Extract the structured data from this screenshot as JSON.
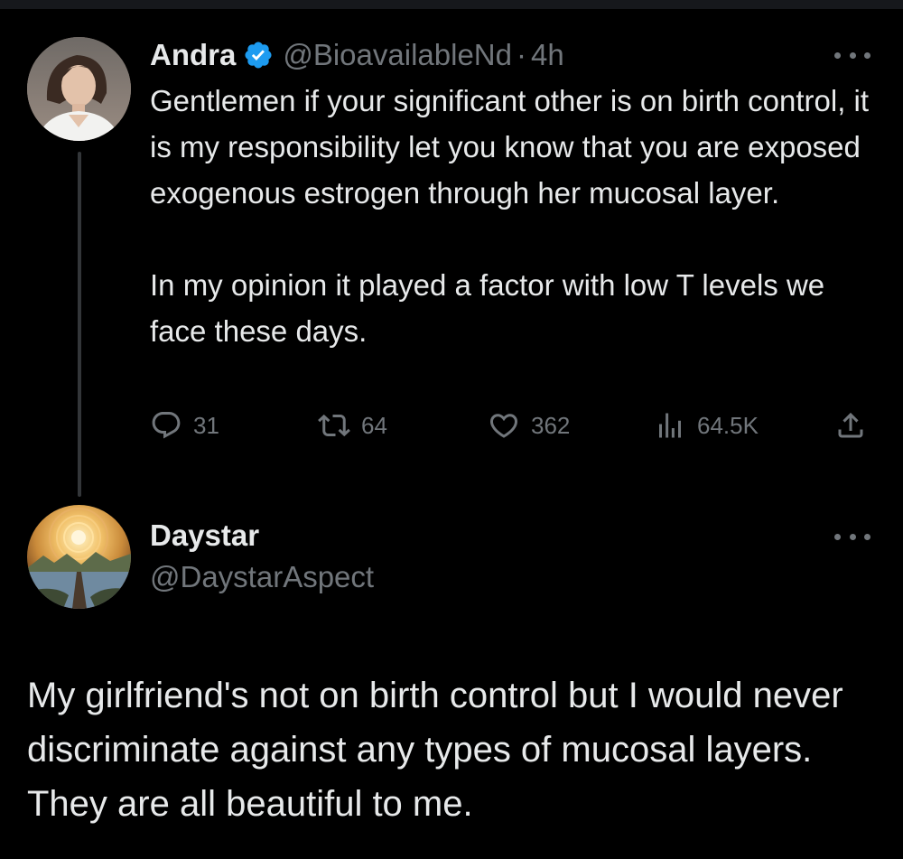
{
  "theme": {
    "background": "#000000",
    "text": "#e7e9ea",
    "muted": "#71767b",
    "verified": "#1d9bf0",
    "thread_line": "#333639"
  },
  "parent_tweet": {
    "display_name": "Andra",
    "verified": true,
    "handle": "@BioavailableNd",
    "separator": "·",
    "time": "4h",
    "more_icon": "more-horizontal-icon",
    "paragraphs": [
      "Gentlemen if your significant other is on birth control, it is my responsibility let you know that you are exposed exogenous estrogen through her mucosal layer.",
      "In my opinion it played a factor with  low T levels we face these days."
    ],
    "actions": {
      "replies": {
        "icon": "reply-icon",
        "count": "31"
      },
      "retweets": {
        "icon": "retweet-icon",
        "count": "64"
      },
      "likes": {
        "icon": "heart-icon",
        "count": "362"
      },
      "views": {
        "icon": "views-icon",
        "count": "64.5K"
      },
      "share": {
        "icon": "share-icon"
      }
    }
  },
  "reply_tweet": {
    "display_name": "Daystar",
    "handle": "@DaystarAspect",
    "more_icon": "more-horizontal-icon",
    "text": "My girlfriend's not on birth control but I would never discriminate against any types of mucosal layers. They are all beautiful to me."
  }
}
